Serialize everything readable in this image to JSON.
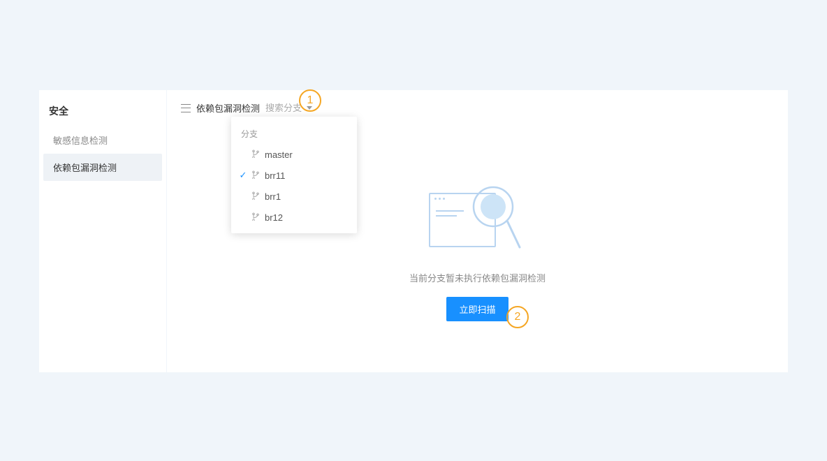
{
  "sidebar": {
    "title": "安全",
    "items": [
      {
        "label": "敏感信息检测",
        "active": false
      },
      {
        "label": "依赖包漏洞检测",
        "active": true
      }
    ]
  },
  "toolbar": {
    "page_title": "依赖包漏洞检测",
    "search_placeholder": "搜索分支"
  },
  "dropdown": {
    "label": "分支",
    "items": [
      {
        "name": "master",
        "selected": false
      },
      {
        "name": "brr11",
        "selected": true
      },
      {
        "name": "brr1",
        "selected": false
      },
      {
        "name": "br12",
        "selected": false
      }
    ]
  },
  "empty": {
    "message": "当前分支暂未执行依赖包漏洞检测",
    "button_label": "立即扫描"
  },
  "callouts": {
    "one": "1",
    "two": "2"
  }
}
